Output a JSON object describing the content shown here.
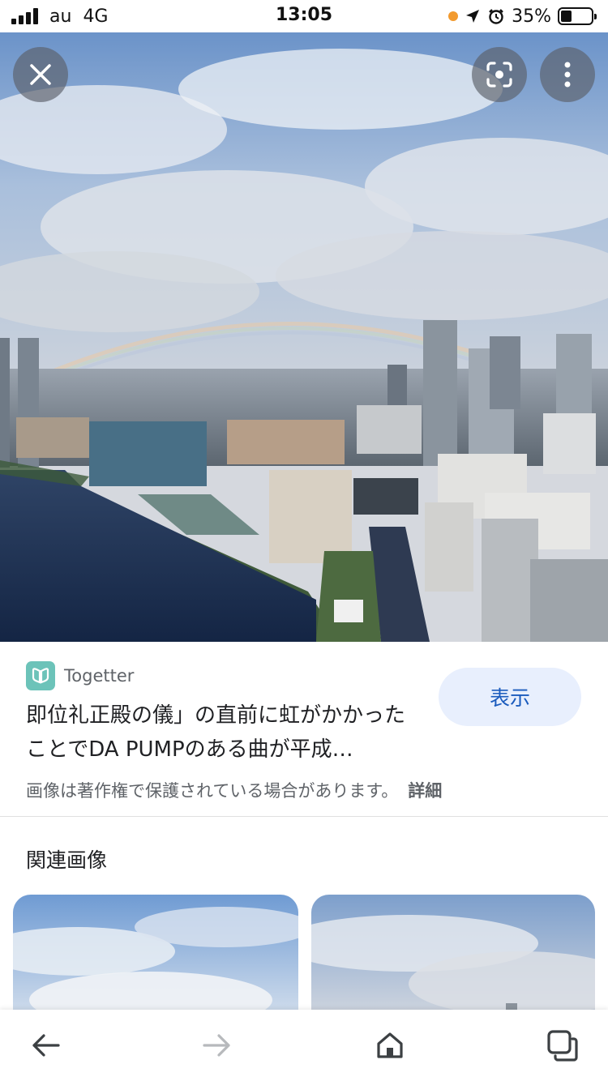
{
  "status_bar": {
    "carrier": "au",
    "network": "4G",
    "time": "13:05",
    "battery": "35%",
    "battery_level": 0.35,
    "icons": [
      "signal-bars-icon",
      "location-dot-icon",
      "location-arrow-icon",
      "alarm-icon",
      "battery-icon"
    ]
  },
  "hero": {
    "description_icons": [
      "close-icon",
      "lens-search-icon",
      "more-vert-icon"
    ]
  },
  "result": {
    "source_name": "Togetter",
    "title": "即位礼正殿の儀」の直前に虹がかかったことでDA PUMPのある曲が平成…",
    "view_button": "表示",
    "copyright_notice": "画像は著作権で保護されている場合があります。",
    "detail_link": "詳細"
  },
  "related": {
    "heading": "関連画像"
  },
  "bottom_nav": {
    "items": [
      "back-arrow-icon",
      "forward-arrow-icon",
      "home-icon",
      "tabs-icon"
    ]
  },
  "colors": {
    "view_button_bg": "#e8effd",
    "view_button_text": "#1a5bbd",
    "source_logo": "#6cc3b9",
    "recording_dot": "#f29a2e"
  }
}
